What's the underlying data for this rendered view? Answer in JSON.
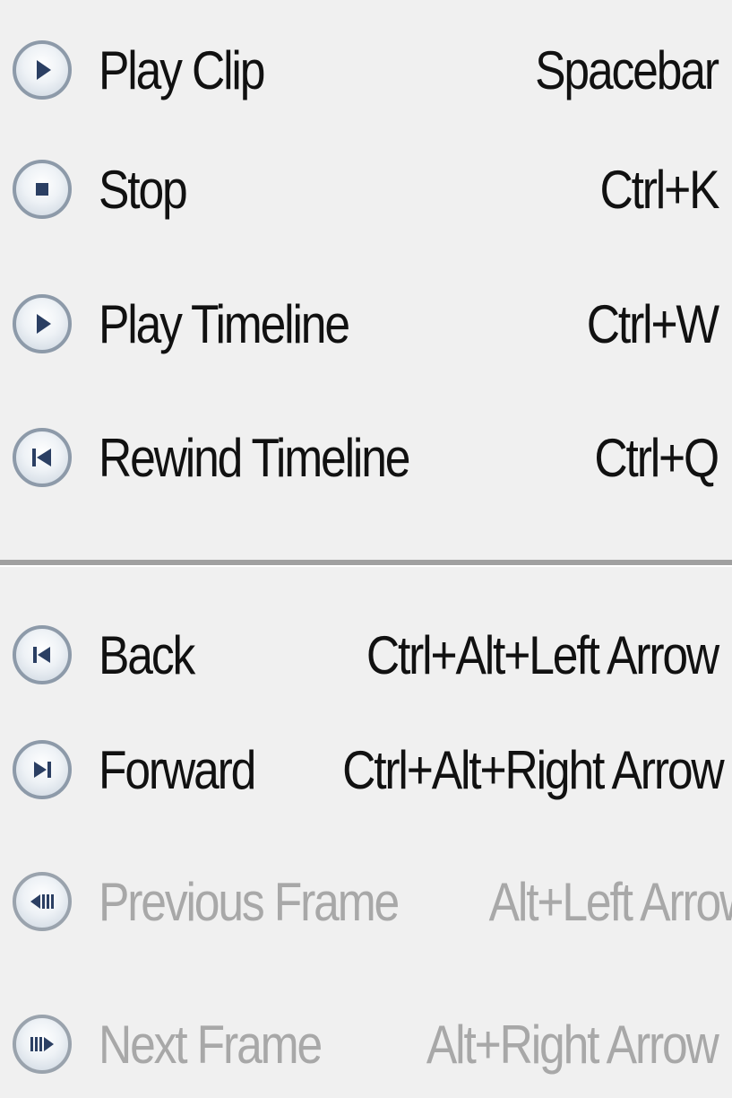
{
  "menu": {
    "items": [
      {
        "label": "Play Clip",
        "shortcut": "Spacebar",
        "icon": "play-icon",
        "enabled": true
      },
      {
        "label": "Stop",
        "shortcut": "Ctrl+K",
        "icon": "stop-icon",
        "enabled": true
      },
      {
        "label": "Play Timeline",
        "shortcut": "Ctrl+W",
        "icon": "play-icon",
        "enabled": true
      },
      {
        "label": "Rewind Timeline",
        "shortcut": "Ctrl+Q",
        "icon": "rewind-icon",
        "enabled": true
      },
      {
        "label": "Back",
        "shortcut": "Ctrl+Alt+Left Arrow",
        "icon": "back-icon",
        "enabled": true
      },
      {
        "label": "Forward",
        "shortcut": "Ctrl+Alt+Right Arrow",
        "icon": "forward-icon",
        "enabled": true
      },
      {
        "label": "Previous Frame",
        "shortcut": "Alt+Left Arrow",
        "icon": "previous-frame-icon",
        "enabled": false
      },
      {
        "label": "Next Frame",
        "shortcut": "Alt+Right Arrow",
        "icon": "next-frame-icon",
        "enabled": false
      }
    ]
  },
  "colors": {
    "background": "#f0f0f0",
    "text": "#111111",
    "disabled_text": "#a8a8a8",
    "icon_glyph": "#2b3f63",
    "separator": "#a0a0a0"
  }
}
